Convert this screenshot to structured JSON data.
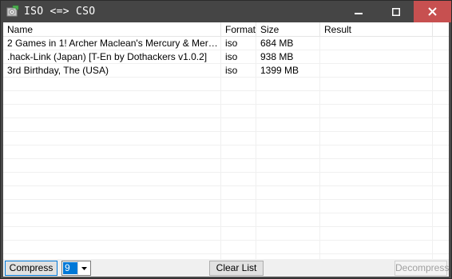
{
  "window": {
    "title": "ISO <=> CSO"
  },
  "listview": {
    "columns": [
      {
        "label": "Name"
      },
      {
        "label": "Format"
      },
      {
        "label": "Size"
      },
      {
        "label": "Result"
      }
    ],
    "rows": [
      {
        "name": "2 Games in 1! Archer Maclean's Mercury & Mercury M...",
        "format": "iso",
        "size": "684 MB",
        "result": ""
      },
      {
        "name": ".hack-Link (Japan) [T-En by Dothackers v1.0.2]",
        "format": "iso",
        "size": "938 MB",
        "result": ""
      },
      {
        "name": "3rd Birthday, The (USA)",
        "format": "iso",
        "size": "1399 MB",
        "result": ""
      }
    ]
  },
  "toolbar": {
    "compress_label": "Compress",
    "level_value": "9",
    "clear_label": "Clear List",
    "decompress_label": "Decompress"
  },
  "icons": {
    "app": "disc-app-icon",
    "minimize": "minimize-icon",
    "maximize": "maximize-icon",
    "close": "close-icon",
    "dropdown": "chevron-down-icon"
  },
  "colors": {
    "titlebar": "#454545",
    "close": "#c75050",
    "selection": "#0078d7"
  }
}
